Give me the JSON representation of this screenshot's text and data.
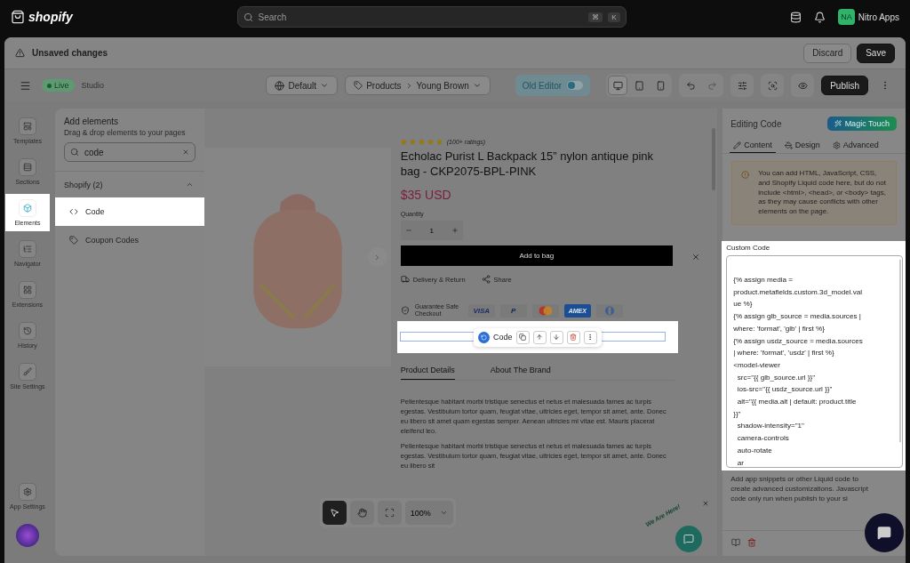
{
  "topbar": {
    "brand": "shopify",
    "search_placeholder": "Search",
    "shortcut_keys": [
      "⌘",
      "K"
    ],
    "avatar_initials": "NA",
    "store_name": "Nitro Apps"
  },
  "notice_bar": {
    "message": "Unsaved changes",
    "buttons": [
      {
        "label": "Discard",
        "kind": "secondary"
      },
      {
        "label": "Save",
        "kind": "primary"
      }
    ]
  },
  "toolbar": {
    "status": "Live",
    "mode": "Studio",
    "locale": "Default",
    "breadcrumb": [
      "Products",
      "Young Brown"
    ],
    "old_editor": {
      "label": "Old Editor",
      "on": false
    },
    "devices": [
      {
        "kind": "desktop",
        "selected": true
      },
      {
        "kind": "tablet",
        "selected": false
      },
      {
        "kind": "mobile",
        "selected": false
      }
    ],
    "publish": "Publish"
  },
  "sidebar": {
    "items": [
      {
        "label": "Templates",
        "kind": "templates",
        "selected": false
      },
      {
        "label": "Sections",
        "kind": "sections",
        "selected": false
      },
      {
        "label": "Elements",
        "kind": "elements",
        "selected": true
      },
      {
        "label": "Navigator",
        "kind": "navigator",
        "selected": false
      },
      {
        "label": "Extensions",
        "kind": "extensions",
        "selected": false
      },
      {
        "label": "History",
        "kind": "history",
        "selected": false
      },
      {
        "label": "Site Settings",
        "kind": "site",
        "selected": false
      }
    ],
    "footer": "App Settings"
  },
  "elements_panel": {
    "title": "Add elements",
    "subtitle": "Drag & drop elements to your pages",
    "search_value": "code",
    "group": {
      "label": "Shopify (2)",
      "expanded": true,
      "items": [
        {
          "label": "Code",
          "kind": "code",
          "highlighted": true
        },
        {
          "label": "Coupon Codes",
          "kind": "coupon",
          "highlighted": false
        }
      ]
    }
  },
  "product": {
    "stars": 5,
    "ratings": "(100+ ratings)",
    "title": "Echolac Purist L Backpack 15” nylon antique pink bag - CKP2075-BPL-PINK",
    "price": "$35 USD",
    "quantity_label": "Quantity",
    "quantity": "1",
    "add_to_bag": "Add to bag",
    "links": [
      {
        "label": "Delivery & Return",
        "kind": "delivery"
      },
      {
        "label": "Share",
        "kind": "share"
      }
    ],
    "guarantee": "Guarantee Safe Checkout",
    "payments": [
      {
        "kind": "visa",
        "label": "VISA"
      },
      {
        "kind": "paypal",
        "label": "P"
      },
      {
        "kind": "mastercard"
      },
      {
        "kind": "amex",
        "label": "AMEX"
      },
      {
        "kind": "diners"
      }
    ],
    "tabs": [
      {
        "label": "Product Details",
        "selected": true
      },
      {
        "label": "About The Brand",
        "selected": false
      }
    ],
    "paragraphs": [
      "Pellentesque habitant morbi tristique senectus et netus et malesuada fames ac turpis egestas. Vestibulum tortor quam, feugiat vitae, ultricies eget, tempor sit amet, ante. Donec eu libero sit amet quam egestas semper. Aenean ultricies mi vitae est. Mauris placerat eleifend leo.",
      "Pellentesque habitant morbi tristique senectus et netus et malesuada fames ac turpis egestas. Vestibulum tortor quam, feugiat vitae, ultricies eget, tempor sit amet, ante. Donec eu libero sit"
    ]
  },
  "code_toolbar": {
    "label": "Code"
  },
  "canvas_tools": {
    "tools": [
      {
        "kind": "pointer",
        "selected": true
      },
      {
        "kind": "hand",
        "selected": false
      },
      {
        "kind": "focus",
        "selected": false
      }
    ],
    "zoom": "100%"
  },
  "chat_widget": {
    "greeting": "We Are Here!"
  },
  "editor_panel": {
    "title": "Editing Code",
    "magic_button": "Magic Touch",
    "tabs": [
      {
        "label": "Content",
        "kind": "content",
        "selected": true
      },
      {
        "label": "Design",
        "kind": "design",
        "selected": false
      },
      {
        "label": "Advanced",
        "kind": "advanced",
        "selected": false
      }
    ],
    "warning": "You can add HTML, JavaScript, CSS, and Shopify Liquid code here, but do not include <html>, <head>, or <body> tags, as they may cause conflicts with other elements on the page.",
    "field_label": "Custom Code",
    "code_lines": [
      "{% assign media =",
      "product.metafields.custom.3d_model.val",
      "ue %}",
      "{% assign glb_source = media.sources |",
      "where: 'format', 'glb' | first %}",
      "{% assign usdz_source = media.sources",
      "| where: 'format', 'usdz' | first %}",
      "<model-viewer",
      "  src=\"{{ glb_source.url }}\"",
      "  ios-src=\"{{ usdz_source.url }}\"",
      "  alt=\"{{ media.alt | default: product.title",
      "}}\"",
      "  shadow-intensity=\"1\"",
      "  camera-controls",
      "  auto-rotate",
      "  ar"
    ],
    "help": "Add app snippets or other Liquid code to create advanced customizations. Javascript code only run when publish to your si"
  }
}
